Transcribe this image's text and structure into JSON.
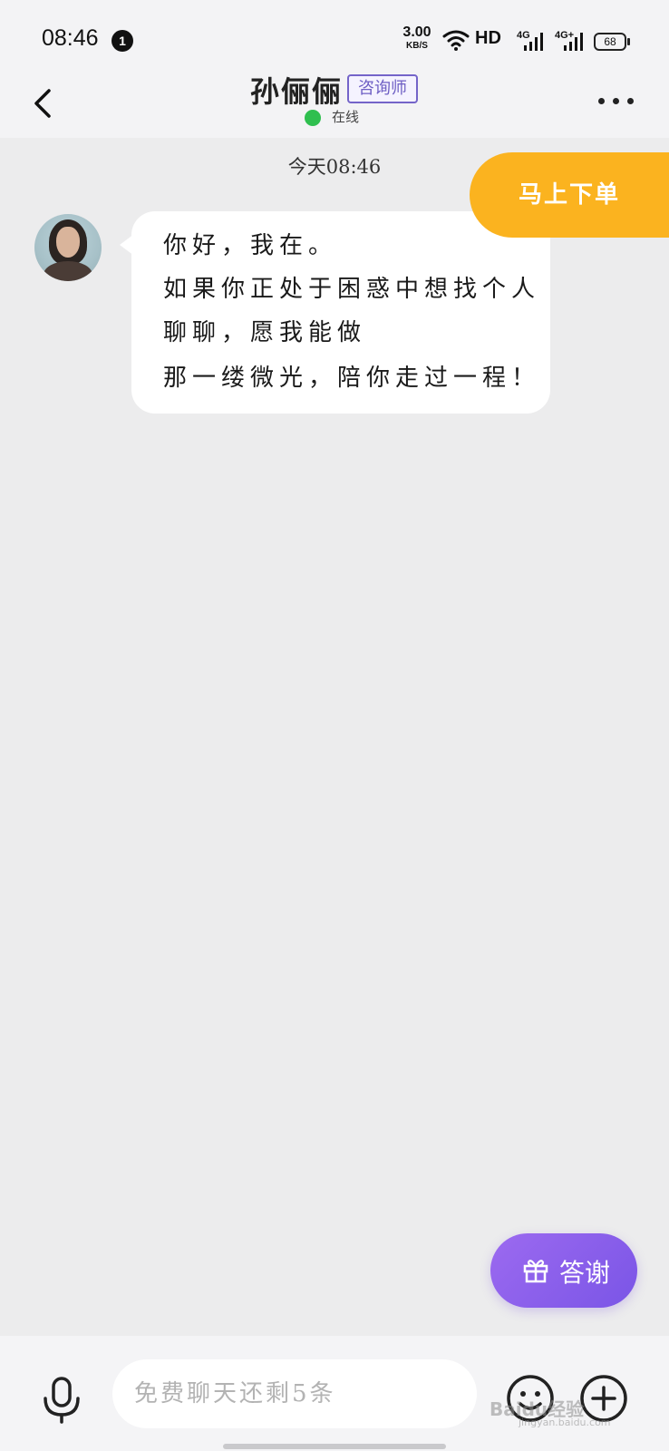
{
  "status_bar": {
    "time": "08:46",
    "notification_count": "1",
    "net_speed_value": "3.00",
    "net_speed_unit": "KB/S",
    "hd_label": "HD",
    "battery_level": "68",
    "icons": [
      "wifi-icon",
      "signal-4g-icon",
      "signal-4g-plus-icon"
    ]
  },
  "header": {
    "contact_name": "孙俪俪",
    "role_badge": "咨询师",
    "status_text": "在线",
    "status_color": "#2fbf4f"
  },
  "chat": {
    "timestamp": "今天08:46",
    "order_button": "马上下单",
    "message_lines": [
      "你好，我在。",
      "如果你正处于困惑中想找个人",
      "聊聊，愿我能做",
      "那一缕微光，陪你走过一程！"
    ]
  },
  "floating": {
    "thanks_label": "答谢"
  },
  "input_bar": {
    "placeholder": "免费聊天还剩5条"
  },
  "watermark": {
    "text": "Baidu经验",
    "sub": "jingyan.baidu.com"
  },
  "colors": {
    "accent_orange": "#fbb31f",
    "accent_purple": "#7a55e6",
    "badge_purple": "#6e5fc4"
  }
}
